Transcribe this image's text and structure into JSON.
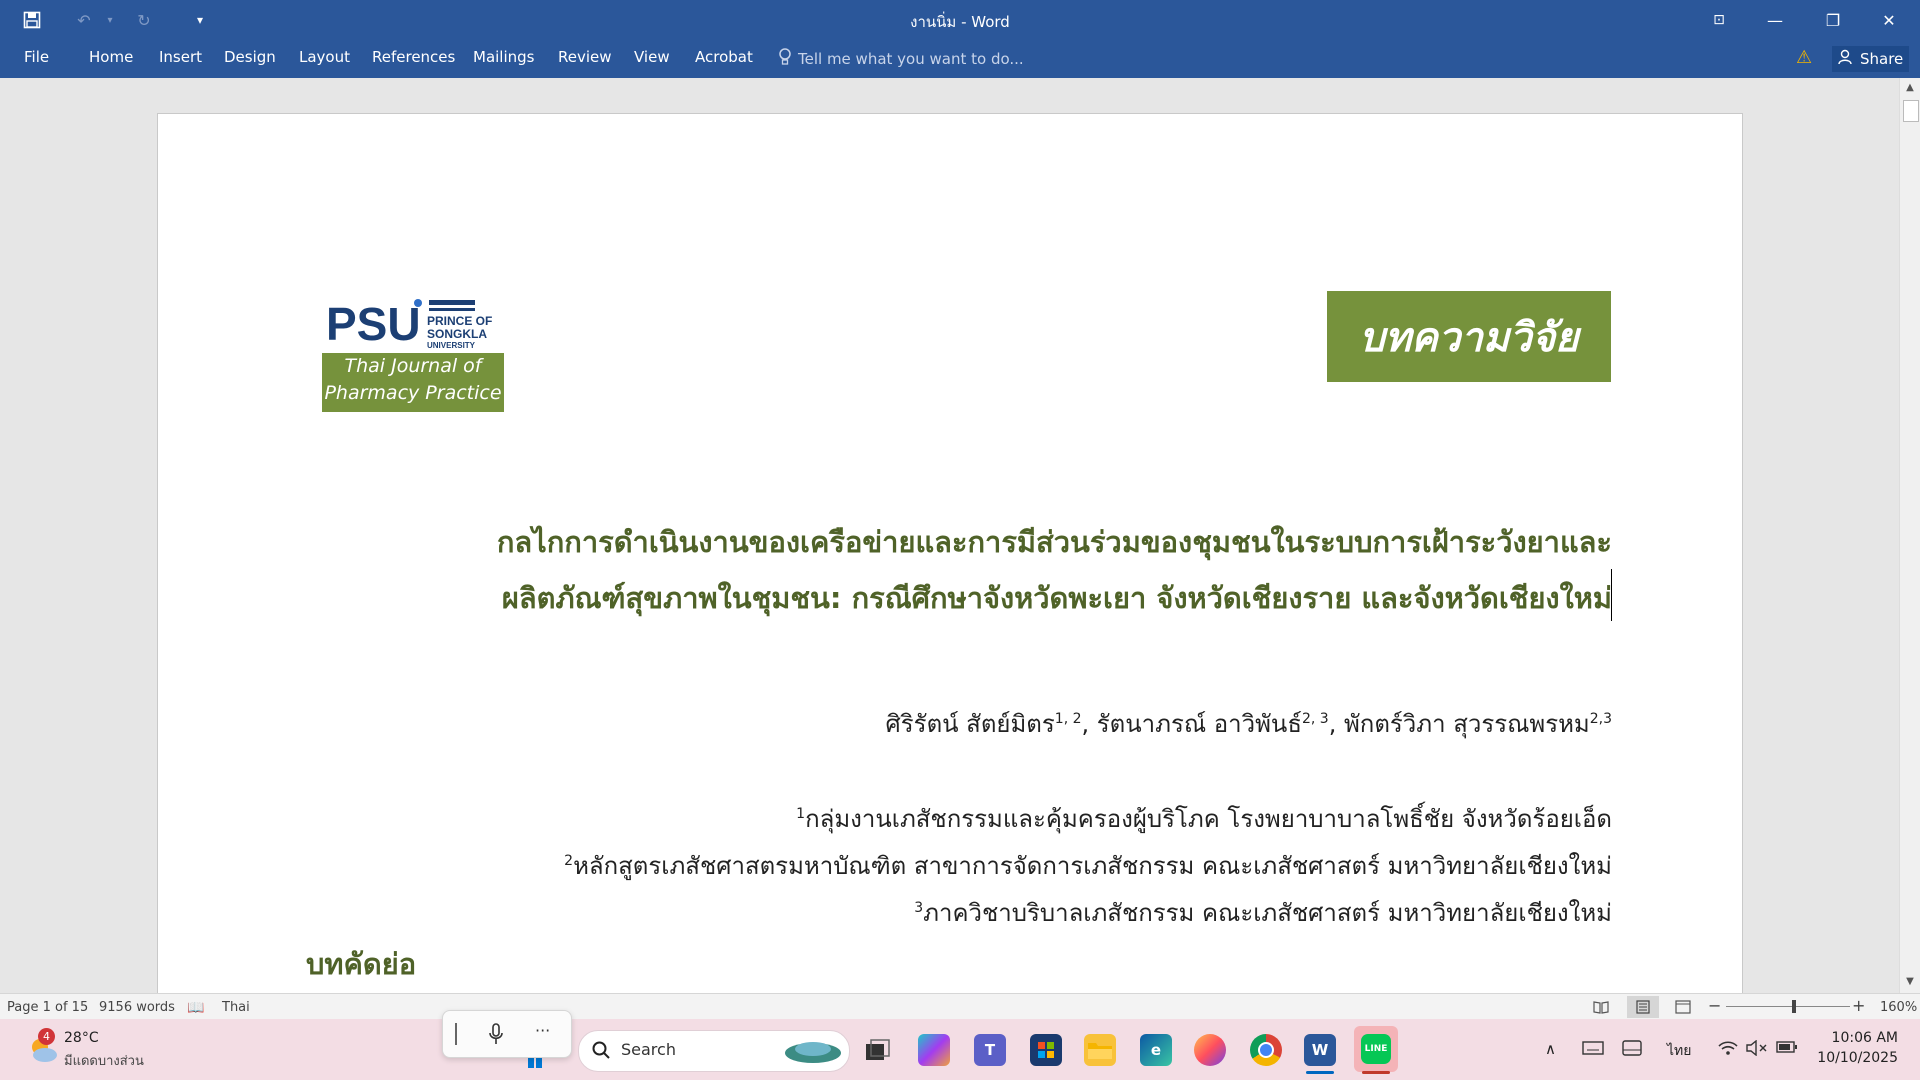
{
  "window": {
    "title": "งานนิ่ม - Word",
    "controls": {
      "ribbon_display": "⊡",
      "minimize": "—",
      "restore": "❐",
      "close": "✕"
    }
  },
  "quick_access": {
    "save": "save-icon",
    "undo": "undo-icon",
    "redo": "redo-icon",
    "customize": "chevron-down-icon"
  },
  "ribbon": {
    "tabs": [
      "File",
      "Home",
      "Insert",
      "Design",
      "Layout",
      "References",
      "Mailings",
      "Review",
      "View",
      "Acrobat"
    ],
    "tell_me": "Tell me what you want to do...",
    "share": "Share",
    "colors": {
      "accent": "#2b579a"
    }
  },
  "document": {
    "logo": {
      "brand": "PSU",
      "line1": "PRINCE OF",
      "line2": "SONGKLA",
      "line3": "UNIVERSITY"
    },
    "journal_line1": "Thai Journal of",
    "journal_line2": "Pharmacy Practice",
    "badge": "บทความวิจัย",
    "title_line1": "กลไกการดำเนินงานของเครือข่ายและการมีส่วนร่วมของชุมชนในระบบการเฝ้าระวังยาและ",
    "title_line2": "ผลิตภัณฑ์สุขภาพในชุมชน: กรณีศึกษาจังหวัดพะเยา จังหวัดเชียงราย และจังหวัดเชียงใหม่",
    "authors": [
      {
        "name": "ศิริรัตน์ สัตย์มิตร",
        "sup": "1, 2"
      },
      {
        "name": "รัตนาภรณ์ อาวิพันธ์",
        "sup": "2, 3"
      },
      {
        "name": "พักตร์วิภา สุวรรณพรหม",
        "sup": "2,3"
      }
    ],
    "affiliations": [
      {
        "sup": "1",
        "text": "กลุ่มงานเภสัชกรรมและคุ้มครองผู้บริโภค โรงพยาบาบาลโพธิ์ชัย จังหวัดร้อยเอ็ด"
      },
      {
        "sup": "2",
        "text": "หลักสูตรเภสัชศาสตรมหาบัณฑิต สาขาการจัดการเภสัชกรรม คณะเภสัชศาสตร์ มหาวิทยาลัยเชียงใหม่"
      },
      {
        "sup": "3",
        "text": "ภาควิชาบริบาลเภสัชกรรม คณะเภสัชศาสตร์ มหาวิทยาลัยเชียงใหม่"
      }
    ],
    "abstract_heading": "บทคัดย่อ",
    "colors": {
      "green": "#76923c",
      "dark_green": "#4f6228"
    }
  },
  "status": {
    "page": "Page 1 of 15",
    "words": "9156 words",
    "language": "Thai",
    "zoom": "160%",
    "zoom_minus": "−",
    "zoom_plus": "+"
  },
  "taskbar": {
    "weather_temp": "28°C",
    "weather_desc": "มีแดดบางส่วน",
    "weather_badge": "4",
    "search": "Search",
    "line_label": "LINE",
    "language": "ไทย",
    "time": "10:06 AM",
    "date": "10/10/2025",
    "voice_more": "···"
  }
}
